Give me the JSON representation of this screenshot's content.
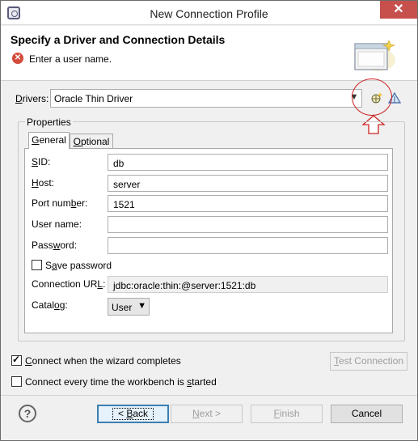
{
  "window": {
    "title": "New Connection Profile",
    "close_glyph": "✕"
  },
  "header": {
    "title": "Specify a Driver and Connection Details",
    "error_message": "Enter a user name.",
    "error_glyph": "✕"
  },
  "drivers": {
    "label": "Drivers:",
    "selected": "Oracle Thin Driver",
    "new_driver_icon": "new-driver-definition-icon",
    "edit_driver_icon": "edit-driver-definition-icon"
  },
  "properties": {
    "group_label": "Properties",
    "tabs": [
      {
        "label": "General",
        "active": true
      },
      {
        "label": "Optional",
        "active": false
      }
    ],
    "fields": [
      {
        "label": "SID:",
        "value": "db"
      },
      {
        "label": "Host:",
        "value": "server"
      },
      {
        "label": "Port number:",
        "value": "1521"
      },
      {
        "label": "User name:",
        "value": ""
      },
      {
        "label": "Password:",
        "value": ""
      }
    ],
    "save_password": {
      "label": "Save password",
      "checked": false
    },
    "connection_url": {
      "label": "Connection URL:",
      "value": "jdbc:oracle:thin:@server:1521:db"
    },
    "catalog": {
      "label": "Catalog:",
      "selected": "User"
    }
  },
  "options": {
    "connect_when_complete": {
      "label": "Connect when the wizard completes",
      "checked": true
    },
    "connect_every_time": {
      "label": "Connect every time the workbench is started",
      "checked": false
    },
    "test_connection_label": "Test Connection"
  },
  "footer": {
    "help_glyph": "?",
    "back_label": "< Back",
    "next_label": "Next >",
    "finish_label": "Finish",
    "cancel_label": "Cancel"
  },
  "colors": {
    "error": "#d34b3b",
    "annotation": "#cc2222",
    "default_button_border": "#3c7fb1"
  }
}
